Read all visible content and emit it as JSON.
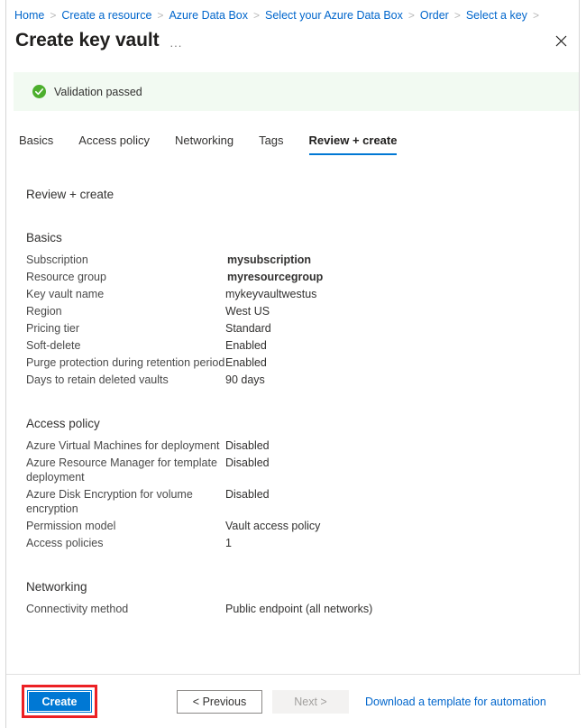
{
  "breadcrumb": {
    "separator": ">",
    "items": [
      "Home",
      "Create a resource",
      "Azure Data Box",
      "Select your Azure Data Box",
      "Order",
      "Select a key"
    ]
  },
  "header": {
    "title": "Create key vault",
    "more_label": "...",
    "close_label": "Close"
  },
  "banner": {
    "text": "Validation passed",
    "icon": "check-circle-icon",
    "background": "#f2faf2",
    "icon_color": "#4caf2d"
  },
  "tabs": [
    {
      "label": "Basics",
      "active": false
    },
    {
      "label": "Access policy",
      "active": false
    },
    {
      "label": "Networking",
      "active": false
    },
    {
      "label": "Tags",
      "active": false
    },
    {
      "label": "Review + create",
      "active": true
    }
  ],
  "content": {
    "page_heading": "Review + create",
    "sections": [
      {
        "title": "Basics",
        "rows": [
          {
            "key": "Subscription",
            "value": "mysubscription",
            "bold": true
          },
          {
            "key": "Resource group",
            "value": "myresourcegroup",
            "bold": true
          },
          {
            "key": "Key vault name",
            "value": "mykeyvaultwestus",
            "bold": false
          },
          {
            "key": "Region",
            "value": "West US",
            "bold": false
          },
          {
            "key": "Pricing tier",
            "value": "Standard",
            "bold": false
          },
          {
            "key": "Soft-delete",
            "value": "Enabled",
            "bold": false
          },
          {
            "key": "Purge protection during retention period",
            "value": "Enabled",
            "bold": false
          },
          {
            "key": "Days to retain deleted vaults",
            "value": "90 days",
            "bold": false
          }
        ]
      },
      {
        "title": "Access policy",
        "rows": [
          {
            "key": "Azure Virtual Machines for deployment",
            "value": "Disabled",
            "bold": false
          },
          {
            "key": "Azure Resource Manager for template deployment",
            "value": "Disabled",
            "bold": false
          },
          {
            "key": "Azure Disk Encryption for volume encryption",
            "value": "Disabled",
            "bold": false
          },
          {
            "key": "Permission model",
            "value": "Vault access policy",
            "bold": false
          },
          {
            "key": "Access policies",
            "value": "1",
            "bold": false
          }
        ]
      },
      {
        "title": "Networking",
        "rows": [
          {
            "key": "Connectivity method",
            "value": "Public endpoint (all networks)",
            "bold": false
          }
        ]
      }
    ]
  },
  "footer": {
    "create_label": "Create",
    "previous_label": "< Previous",
    "next_label": "Next >",
    "download_label": "Download a template for automation",
    "create_highlight_color": "#ec2024",
    "create_button_color": "#0078d4",
    "link_color": "#0066cc"
  }
}
